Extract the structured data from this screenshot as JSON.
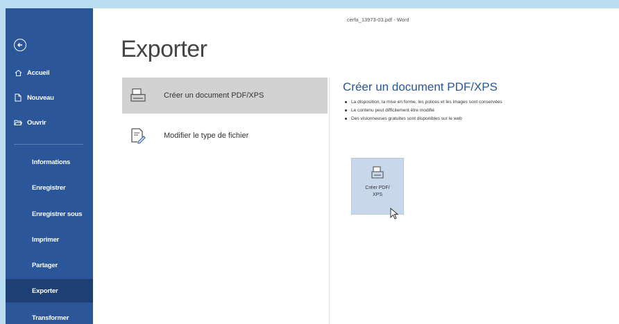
{
  "window": {
    "title": "cerfa_13973-03.pdf  -  Word"
  },
  "sidebar": {
    "top_items": [
      {
        "label": "Accueil",
        "icon": "home-icon"
      },
      {
        "label": "Nouveau",
        "icon": "new-document-icon"
      },
      {
        "label": "Ouvrir",
        "icon": "folder-open-icon"
      }
    ],
    "sub_items": [
      {
        "label": "Informations"
      },
      {
        "label": "Enregistrer"
      },
      {
        "label": "Enregistrer sous"
      },
      {
        "label": "Imprimer"
      },
      {
        "label": "Partager"
      },
      {
        "label": "Exporter",
        "active": true
      },
      {
        "label": "Transformer"
      }
    ]
  },
  "main": {
    "page_title": "Exporter",
    "options": [
      {
        "label": "Créer un document PDF/XPS",
        "selected": true,
        "icon": "pdf-document-icon"
      },
      {
        "label": "Modifier le type de fichier",
        "selected": false,
        "icon": "change-file-type-icon"
      }
    ],
    "detail": {
      "title": "Créer un document PDF/XPS",
      "bullets": [
        "La disposition, la mise en forme, les polices et les images sont conservées",
        "Le contenu peut difficilement être modifié",
        "Des visionneuses gratuites sont disponibles sur le web"
      ],
      "button_label": "Créer PDF/ XPS"
    }
  },
  "colors": {
    "sidebar": "#2b579a",
    "sidebar_active": "#1e3f73",
    "accent_text": "#2b579a",
    "selected_option": "#d2d2d2",
    "button_bg": "#c8d7ea",
    "frame": "#b9def2"
  }
}
